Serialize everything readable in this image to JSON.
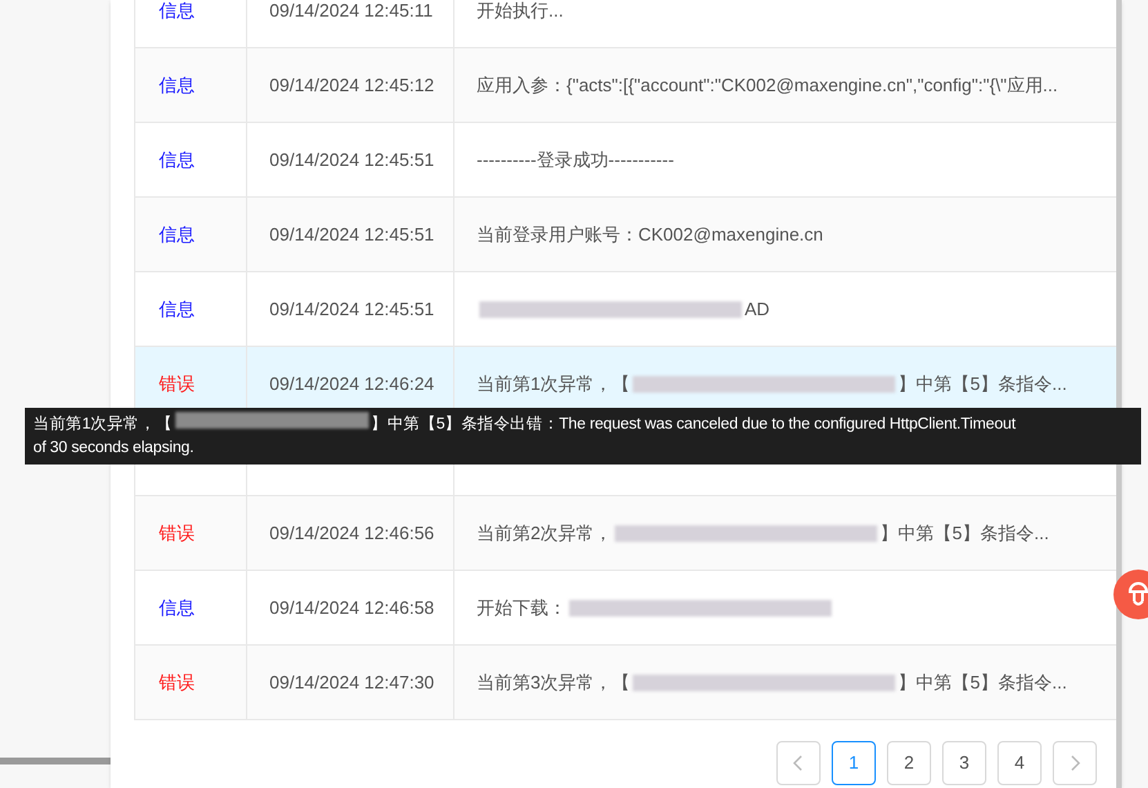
{
  "log_table": {
    "rows": [
      {
        "kind": "info",
        "level_label": "信息",
        "time": "09/14/2024 12:45:11",
        "message": [
          {
            "kind": "text",
            "text": "开始执行..."
          }
        ],
        "selected": false
      },
      {
        "kind": "info",
        "level_label": "信息",
        "time": "09/14/2024 12:45:12",
        "message": [
          {
            "kind": "text",
            "text": "应用入参：{\"acts\":[{\"account\":\"CK002@maxengine.cn\",\"config\":\"{\\\"应用..."
          }
        ],
        "selected": false
      },
      {
        "kind": "info",
        "level_label": "信息",
        "time": "09/14/2024 12:45:51",
        "message": [
          {
            "kind": "text",
            "text": "----------登录成功-----------"
          }
        ],
        "selected": false
      },
      {
        "kind": "info",
        "level_label": "信息",
        "time": "09/14/2024 12:45:51",
        "message": [
          {
            "kind": "text",
            "text": "当前登录用户账号：CK002@maxengine.cn"
          }
        ],
        "selected": false
      },
      {
        "kind": "info",
        "level_label": "信息",
        "time": "09/14/2024 12:45:51",
        "message": [
          {
            "kind": "redacted"
          },
          {
            "kind": "text",
            "text": "AD"
          }
        ],
        "selected": false
      },
      {
        "kind": "error",
        "level_label": "错误",
        "time": "09/14/2024 12:46:24",
        "message": [
          {
            "kind": "text",
            "text": "当前第1次异常，【"
          },
          {
            "kind": "redacted"
          },
          {
            "kind": "text",
            "text": "】中第【5】条指令..."
          }
        ],
        "selected": true
      },
      {
        "message": [],
        "selected": false
      },
      {
        "kind": "error",
        "level_label": "错误",
        "time": "09/14/2024 12:46:56",
        "message": [
          {
            "kind": "text",
            "text": "当前第2次异常，"
          },
          {
            "kind": "redacted"
          },
          {
            "kind": "text",
            "text": "】中第【5】条指令..."
          }
        ],
        "selected": false
      },
      {
        "kind": "info",
        "level_label": "信息",
        "time": "09/14/2024 12:46:58",
        "message": [
          {
            "kind": "text",
            "text": "开始下载："
          },
          {
            "kind": "redacted"
          }
        ],
        "selected": false
      },
      {
        "kind": "error",
        "level_label": "错误",
        "time": "09/14/2024 12:47:30",
        "message": [
          {
            "kind": "text",
            "text": "当前第3次异常，【"
          },
          {
            "kind": "redacted"
          },
          {
            "kind": "text",
            "text": "】中第【5】条指令..."
          }
        ],
        "selected": false
      }
    ]
  },
  "tooltip": {
    "lines": [
      [
        {
          "kind": "text",
          "text": "当前第1次异常，【"
        },
        {
          "kind": "redacted"
        },
        {
          "kind": "text",
          "text": "】中第【5】条指令出错：The request was canceled due to the configured HttpClient.Timeout"
        }
      ],
      [
        {
          "kind": "text",
          "text": "of 30 seconds elapsing."
        }
      ]
    ]
  },
  "pagination": {
    "pages": [
      {
        "label": "1",
        "selected": true
      },
      {
        "label": "2",
        "selected": false
      },
      {
        "label": "3",
        "selected": false
      },
      {
        "label": "4",
        "selected": false
      }
    ]
  }
}
